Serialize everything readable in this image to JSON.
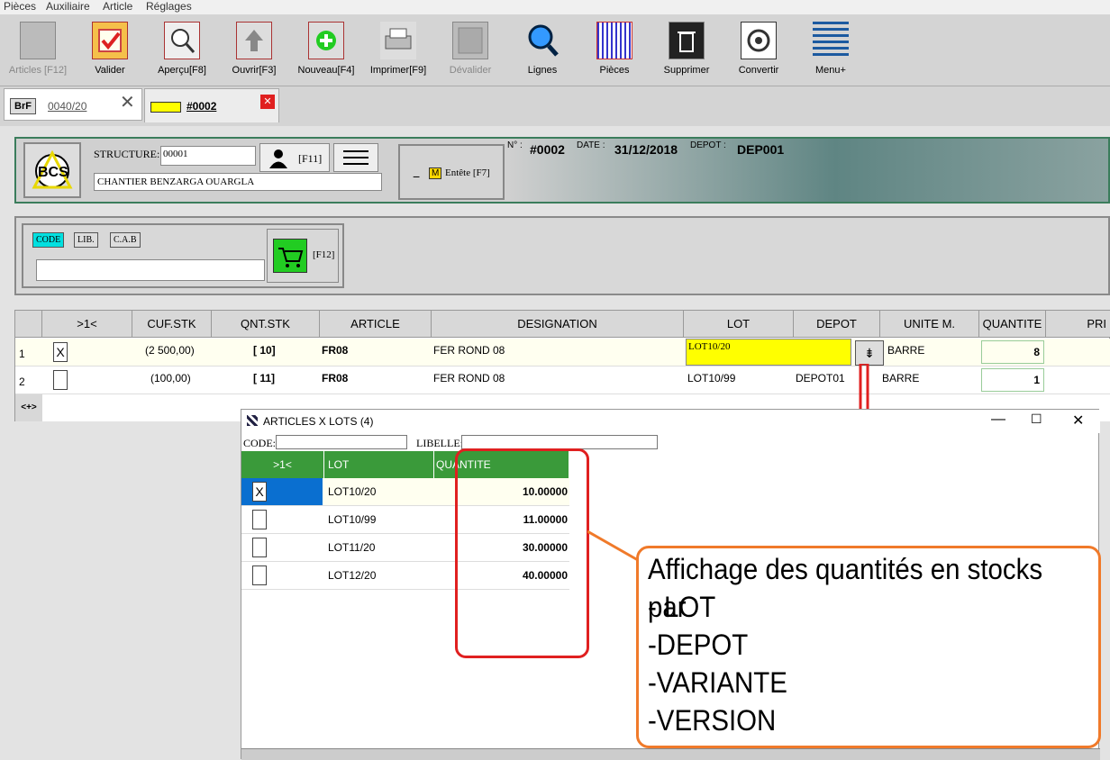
{
  "menu": [
    "Pièces",
    "Auxiliaire",
    "Article",
    "Réglages"
  ],
  "toolbar": [
    {
      "label": "Articles [F12]",
      "icon": "articles-icon",
      "disabled": true
    },
    {
      "label": "Valider",
      "icon": "checkmark-icon"
    },
    {
      "label": "Aperçu[F8]",
      "icon": "magnifier-icon"
    },
    {
      "label": "Ouvrir[F3]",
      "icon": "up-arrow-icon"
    },
    {
      "label": "Nouveau[F4]",
      "icon": "plus-icon"
    },
    {
      "label": "Imprimer[F9]",
      "icon": "printer-icon"
    },
    {
      "label": "Dévalider",
      "icon": "square-icon",
      "disabled": true
    },
    {
      "label": "Lignes",
      "icon": "search-lens-icon"
    },
    {
      "label": "Pièces",
      "icon": "grid-icon"
    },
    {
      "label": "Supprimer",
      "icon": "trash-icon"
    },
    {
      "label": "Convertir",
      "icon": "convert-icon"
    },
    {
      "label": "Menu+",
      "icon": "menu-lines-icon"
    }
  ],
  "tabs": {
    "tab1_badge": "BrF",
    "tab1_label": "0040/20",
    "tab2_label": "#0002"
  },
  "header": {
    "structure_label": "STRUCTURE:",
    "structure_value": "00001",
    "client_name": "CHANTIER BENZARGA OUARGLA",
    "f11": "[F11]",
    "entete": "Entête [F7]",
    "entete_badge": "M",
    "num_label": "N° :",
    "num_value": "#0002",
    "date_label": "DATE :",
    "date_value": "31/12/2018",
    "depot_label": "DEPOT :",
    "depot_value": "DEP001",
    "logo": "BCS"
  },
  "search": {
    "btn_code": "CODE",
    "btn_lib": "LIB.",
    "btn_cab": "C.A.B",
    "f12": "[F12]"
  },
  "grid": {
    "headers": [
      ">1<",
      "CUF.STK",
      "QNT.STK",
      "ARTICLE",
      "DESIGNATION",
      "LOT",
      "DEPOT",
      "UNITE M.",
      "QUANTITE",
      "PRI"
    ],
    "rows": [
      {
        "n": "1",
        "chk": "X",
        "cuf": "(2 500,00)",
        "qnt": "[ 10]",
        "article": "FR08",
        "designation": "FER ROND 08",
        "lot": "LOT10/20",
        "depot": "",
        "unite": "BARRE",
        "quantite": "8"
      },
      {
        "n": "2",
        "chk": "",
        "cuf": "(100,00)",
        "qnt": "[ 11]",
        "article": "FR08",
        "designation": "FER ROND 08",
        "lot": "LOT10/99",
        "depot": "DEPOT01",
        "unite": "BARRE",
        "quantite": "1"
      }
    ],
    "nav": "<+>"
  },
  "popup": {
    "title": "ARTICLES X LOTS (4)",
    "code_label": "CODE:",
    "libelle_label": "LIBELLE:",
    "headers": [
      ">1<",
      "LOT",
      "QUANTITE"
    ],
    "rows": [
      {
        "chk": "X",
        "lot": "LOT10/20",
        "qte": "10.00000"
      },
      {
        "chk": "",
        "lot": "LOT10/99",
        "qte": "11.00000"
      },
      {
        "chk": "",
        "lot": "LOT11/20",
        "qte": "30.00000"
      },
      {
        "chk": "",
        "lot": "LOT12/20",
        "qte": "40.00000"
      }
    ]
  },
  "callout": [
    "Affichage des quantités en stocks par",
    "- LOT",
    "-DEPOT",
    "-VARIANTE",
    "-VERSION"
  ],
  "colors": {
    "green": "#3a9a3a",
    "yellow": "#ffff00",
    "red": "#e02020",
    "orange": "#f07a2a"
  }
}
